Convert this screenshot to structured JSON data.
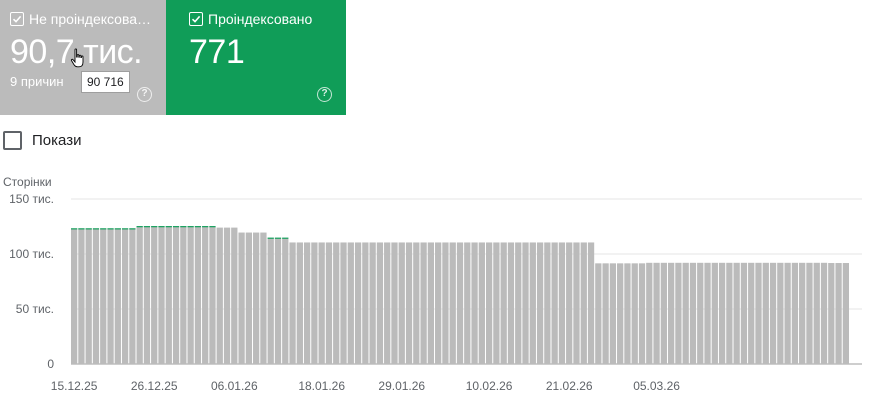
{
  "cards": {
    "not_indexed": {
      "label": "Не проіндексова…",
      "value": "90,7 тис.",
      "subtitle": "9 причин",
      "tooltip": "90 716",
      "help": "?",
      "color": "#bbbbbb"
    },
    "indexed": {
      "label": "Проіндексовано",
      "value": "771",
      "help": "?",
      "color": "#109d58"
    }
  },
  "show_checkbox": {
    "label": "Покази",
    "checked": false
  },
  "chart_data": {
    "type": "bar",
    "ylabel": "Сторінки",
    "ylim": [
      0,
      150000
    ],
    "yticks": [
      {
        "value": 0,
        "label": "0"
      },
      {
        "value": 50000,
        "label": "50 тис."
      },
      {
        "value": 100000,
        "label": "100 тис."
      },
      {
        "value": 150000,
        "label": "150 тис."
      }
    ],
    "xticks": [
      {
        "index": 0,
        "label": "15.12.25"
      },
      {
        "index": 11,
        "label": "26.12.25"
      },
      {
        "index": 22,
        "label": "06.01.26"
      },
      {
        "index": 34,
        "label": "18.01.26"
      },
      {
        "index": 45,
        "label": "29.01.26"
      },
      {
        "index": 57,
        "label": "10.02.26"
      },
      {
        "index": 68,
        "label": "21.02.26"
      },
      {
        "index": 80,
        "label": "05.03.26"
      }
    ],
    "series": [
      {
        "name": "Не проіндексовано",
        "color": "#bbbbbb",
        "values": [
          122500,
          122500,
          122500,
          122500,
          122500,
          122500,
          122500,
          122500,
          122500,
          124500,
          124500,
          124500,
          124500,
          124500,
          124500,
          124500,
          124500,
          124500,
          124500,
          124500,
          124000,
          124000,
          124000,
          119500,
          119500,
          119500,
          119500,
          114000,
          114000,
          114000,
          110500,
          110500,
          110500,
          110500,
          110500,
          110500,
          110500,
          110500,
          110500,
          110500,
          110500,
          110500,
          110500,
          110500,
          110500,
          110500,
          110500,
          110500,
          110500,
          110500,
          110500,
          110500,
          110500,
          110500,
          110500,
          110500,
          110500,
          110500,
          110500,
          110500,
          110500,
          110500,
          110500,
          110500,
          110500,
          110500,
          110500,
          110500,
          110500,
          110500,
          110500,
          110500,
          91500,
          91500,
          91500,
          91500,
          91500,
          91500,
          91500,
          92000,
          92000,
          92000,
          92000,
          92000,
          92000,
          92000,
          92000,
          92000,
          92000,
          92000,
          92000,
          92000,
          92000,
          92000,
          92000,
          92000,
          92000,
          92000,
          92000,
          92000,
          92000,
          92000,
          92000,
          92000,
          91800,
          91800,
          91800
        ]
      },
      {
        "name": "Проіндексовано",
        "color": "#109d58",
        "values": [
          900,
          900,
          900,
          900,
          900,
          900,
          900,
          900,
          900,
          900,
          900,
          900,
          900,
          900,
          900,
          900,
          900,
          900,
          900,
          900,
          0,
          0,
          0,
          0,
          0,
          0,
          0,
          900,
          900,
          900,
          0,
          0,
          0,
          0,
          0,
          0,
          0,
          0,
          0,
          0,
          0,
          0,
          0,
          0,
          0,
          0,
          0,
          0,
          0,
          0,
          0,
          0,
          0,
          0,
          0,
          0,
          0,
          0,
          0,
          0,
          0,
          0,
          0,
          0,
          0,
          0,
          0,
          0,
          0,
          0,
          0,
          0,
          0,
          0,
          0,
          0,
          0,
          0,
          0,
          0,
          0,
          0,
          0,
          0,
          0,
          0,
          0,
          0,
          0,
          0,
          0,
          0,
          0,
          0,
          0,
          0,
          0,
          0,
          0,
          0,
          0,
          0,
          0,
          0,
          0,
          0,
          0
        ]
      }
    ]
  }
}
